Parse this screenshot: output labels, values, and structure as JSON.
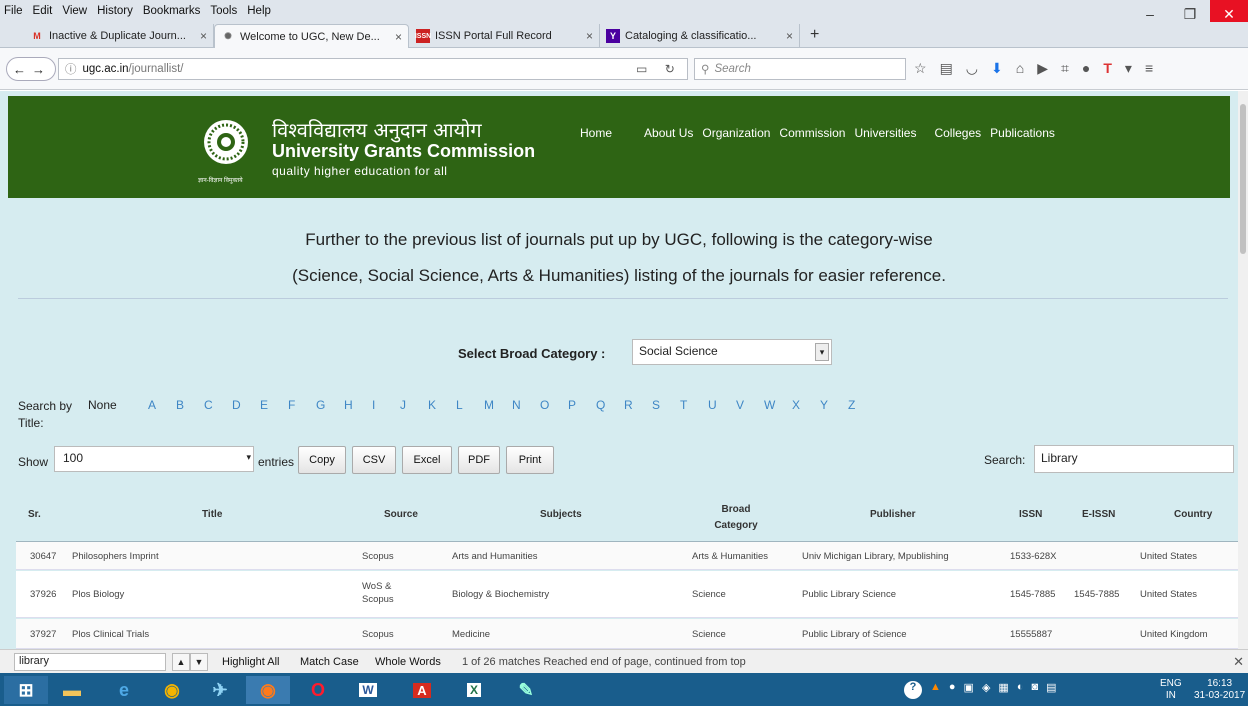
{
  "menubar": {
    "items": [
      "File",
      "Edit",
      "View",
      "History",
      "Bookmarks",
      "Tools",
      "Help"
    ]
  },
  "tabs": [
    {
      "title": "Inactive & Duplicate Journ...",
      "icon": "gmail-icon",
      "close": "×"
    },
    {
      "title": "Welcome to UGC, New De...",
      "icon": "ugc-icon",
      "close": "×"
    },
    {
      "title": "ISSN Portal Full Record",
      "icon": "issn-icon",
      "close": "×"
    },
    {
      "title": "Cataloging & classificatio...",
      "icon": "yahoo-icon",
      "close": "×"
    }
  ],
  "newtab": "+",
  "url": {
    "host": "ugc.ac.in",
    "path": "/journallist/"
  },
  "search_placeholder": "Search",
  "header": {
    "hindi": "विश्वविद्यालय अनुदान आयोग",
    "name": "University Grants Commission",
    "tagline": "quality higher education for all",
    "tag_small": "ज्ञान-विज्ञान विमुक्तये",
    "nav": [
      "Home",
      "About Us",
      "Organization",
      "Commission",
      "Universities",
      "Colleges",
      "Publications"
    ]
  },
  "intro": {
    "line1": "Further to the previous list of journals put up by UGC, following is the category-wise",
    "line2": "(Science, Social Science, Arts & Humanities) listing of the journals for easier reference."
  },
  "category": {
    "label": "Select Broad Category :",
    "selected": "Social Science"
  },
  "search_by": {
    "label1": "Search by",
    "label2": "Title:",
    "none": "None",
    "letters": [
      "A",
      "B",
      "C",
      "D",
      "E",
      "F",
      "G",
      "H",
      "I",
      "J",
      "K",
      "L",
      "M",
      "N",
      "O",
      "P",
      "Q",
      "R",
      "S",
      "T",
      "U",
      "V",
      "W",
      "X",
      "Y",
      "Z"
    ]
  },
  "show": {
    "label": "Show",
    "value": "100",
    "entries": "entries"
  },
  "export_buttons": [
    "Copy",
    "CSV",
    "Excel",
    "PDF",
    "Print"
  ],
  "table_search": {
    "label": "Search:",
    "value": "Library"
  },
  "table": {
    "headers": [
      "Sr.",
      "Title",
      "Source",
      "Subjects",
      "Broad Category",
      "Publisher",
      "ISSN",
      "E-ISSN",
      "Country"
    ],
    "rows": [
      {
        "sr": "30647",
        "title": "Philosophers Imprint",
        "source": "Scopus",
        "subjects": "Arts and Humanities",
        "broad": "Arts & Humanities",
        "publisher": "Univ Michigan Library, Mpublishing",
        "issn": "1533-628X",
        "eissn": "",
        "country": "United States"
      },
      {
        "sr": "37926",
        "title": "Plos Biology",
        "source": "WoS & Scopus",
        "subjects": "Biology & Biochemistry",
        "broad": "Science",
        "publisher": "Public Library Science",
        "issn": "1545-7885",
        "eissn": "1545-7885",
        "country": "United States"
      },
      {
        "sr": "37927",
        "title": "Plos Clinical Trials",
        "source": "Scopus",
        "subjects": "Medicine",
        "broad": "Science",
        "publisher": "Public Library of Science",
        "issn": "15555887",
        "eissn": "",
        "country": "United Kingdom"
      }
    ]
  },
  "findbar": {
    "query": "library",
    "highlight": "Highlight All",
    "matchcase": "Match Case",
    "wholewords": "Whole Words",
    "status": "1 of 26 matches   Reached end of page, continued from top"
  },
  "tray": {
    "lang": "ENG",
    "region": "IN",
    "time": "16:13",
    "date": "31-03-2017"
  }
}
